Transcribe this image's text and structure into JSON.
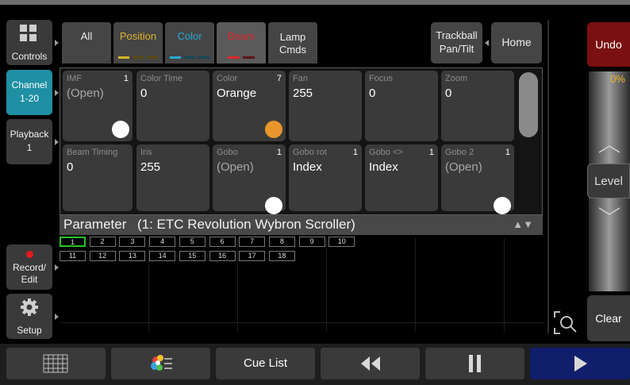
{
  "sidebar": {
    "controls": "Controls",
    "channel_line1": "Channel",
    "channel_line2": "1-20",
    "playback_line1": "Playback",
    "playback_line2": "1",
    "record_line1": "Record/",
    "record_line2": "Edit",
    "setup": "Setup"
  },
  "tabs": {
    "all": "All",
    "position": "Position",
    "color": "Color",
    "beam": "Beam",
    "lamp_line1": "Lamp",
    "lamp_line2": "Cmds",
    "trackball_line1": "Trackball",
    "trackball_line2": "Pan/Tilt",
    "home": "Home"
  },
  "params": [
    {
      "name": "IMF",
      "count": "1",
      "value": "(Open)"
    },
    {
      "name": "Color Time",
      "count": "",
      "value": "0"
    },
    {
      "name": "Color",
      "count": "7",
      "value": "Orange"
    },
    {
      "name": "Fan",
      "count": "",
      "value": "255"
    },
    {
      "name": "Focus",
      "count": "",
      "value": "0"
    },
    {
      "name": "Zoom",
      "count": "",
      "value": "0"
    },
    {
      "name": "Beam Timing",
      "count": "",
      "value": "0"
    },
    {
      "name": "Iris",
      "count": "",
      "value": "255"
    },
    {
      "name": "Gobo",
      "count": "1",
      "value": "(Open)"
    },
    {
      "name": "Gobo rot",
      "count": "1",
      "value": "Index"
    },
    {
      "name": "Gobo <>",
      "count": "1",
      "value": "Index"
    },
    {
      "name": "Gobo 2",
      "count": "1",
      "value": "(Open)"
    }
  ],
  "parameter_bar": {
    "label": "Parameter",
    "fixture": "(1: ETC Revolution Wybron Scroller)",
    "sort_icon": "▲▼"
  },
  "channels": [
    "1",
    "2",
    "3",
    "4",
    "5",
    "6",
    "7",
    "8",
    "9",
    "10",
    "11",
    "12",
    "13",
    "14",
    "15",
    "16",
    "17",
    "18"
  ],
  "right_panel": {
    "undo": "Undo",
    "level_percent": "0%",
    "level": "Level",
    "clear": "Clear"
  },
  "bottom_bar": {
    "cue_list": "Cue List"
  },
  "colors": {
    "accent": "#1f8fa3",
    "undo_red": "#7a1010",
    "selected_green": "#29c229",
    "knob_orange": "#e8962c",
    "play_blue": "#0f1f6b",
    "position_yellow": "#d9b32c",
    "color_cyan": "#29a7d6",
    "beam_red": "#d9292e"
  }
}
